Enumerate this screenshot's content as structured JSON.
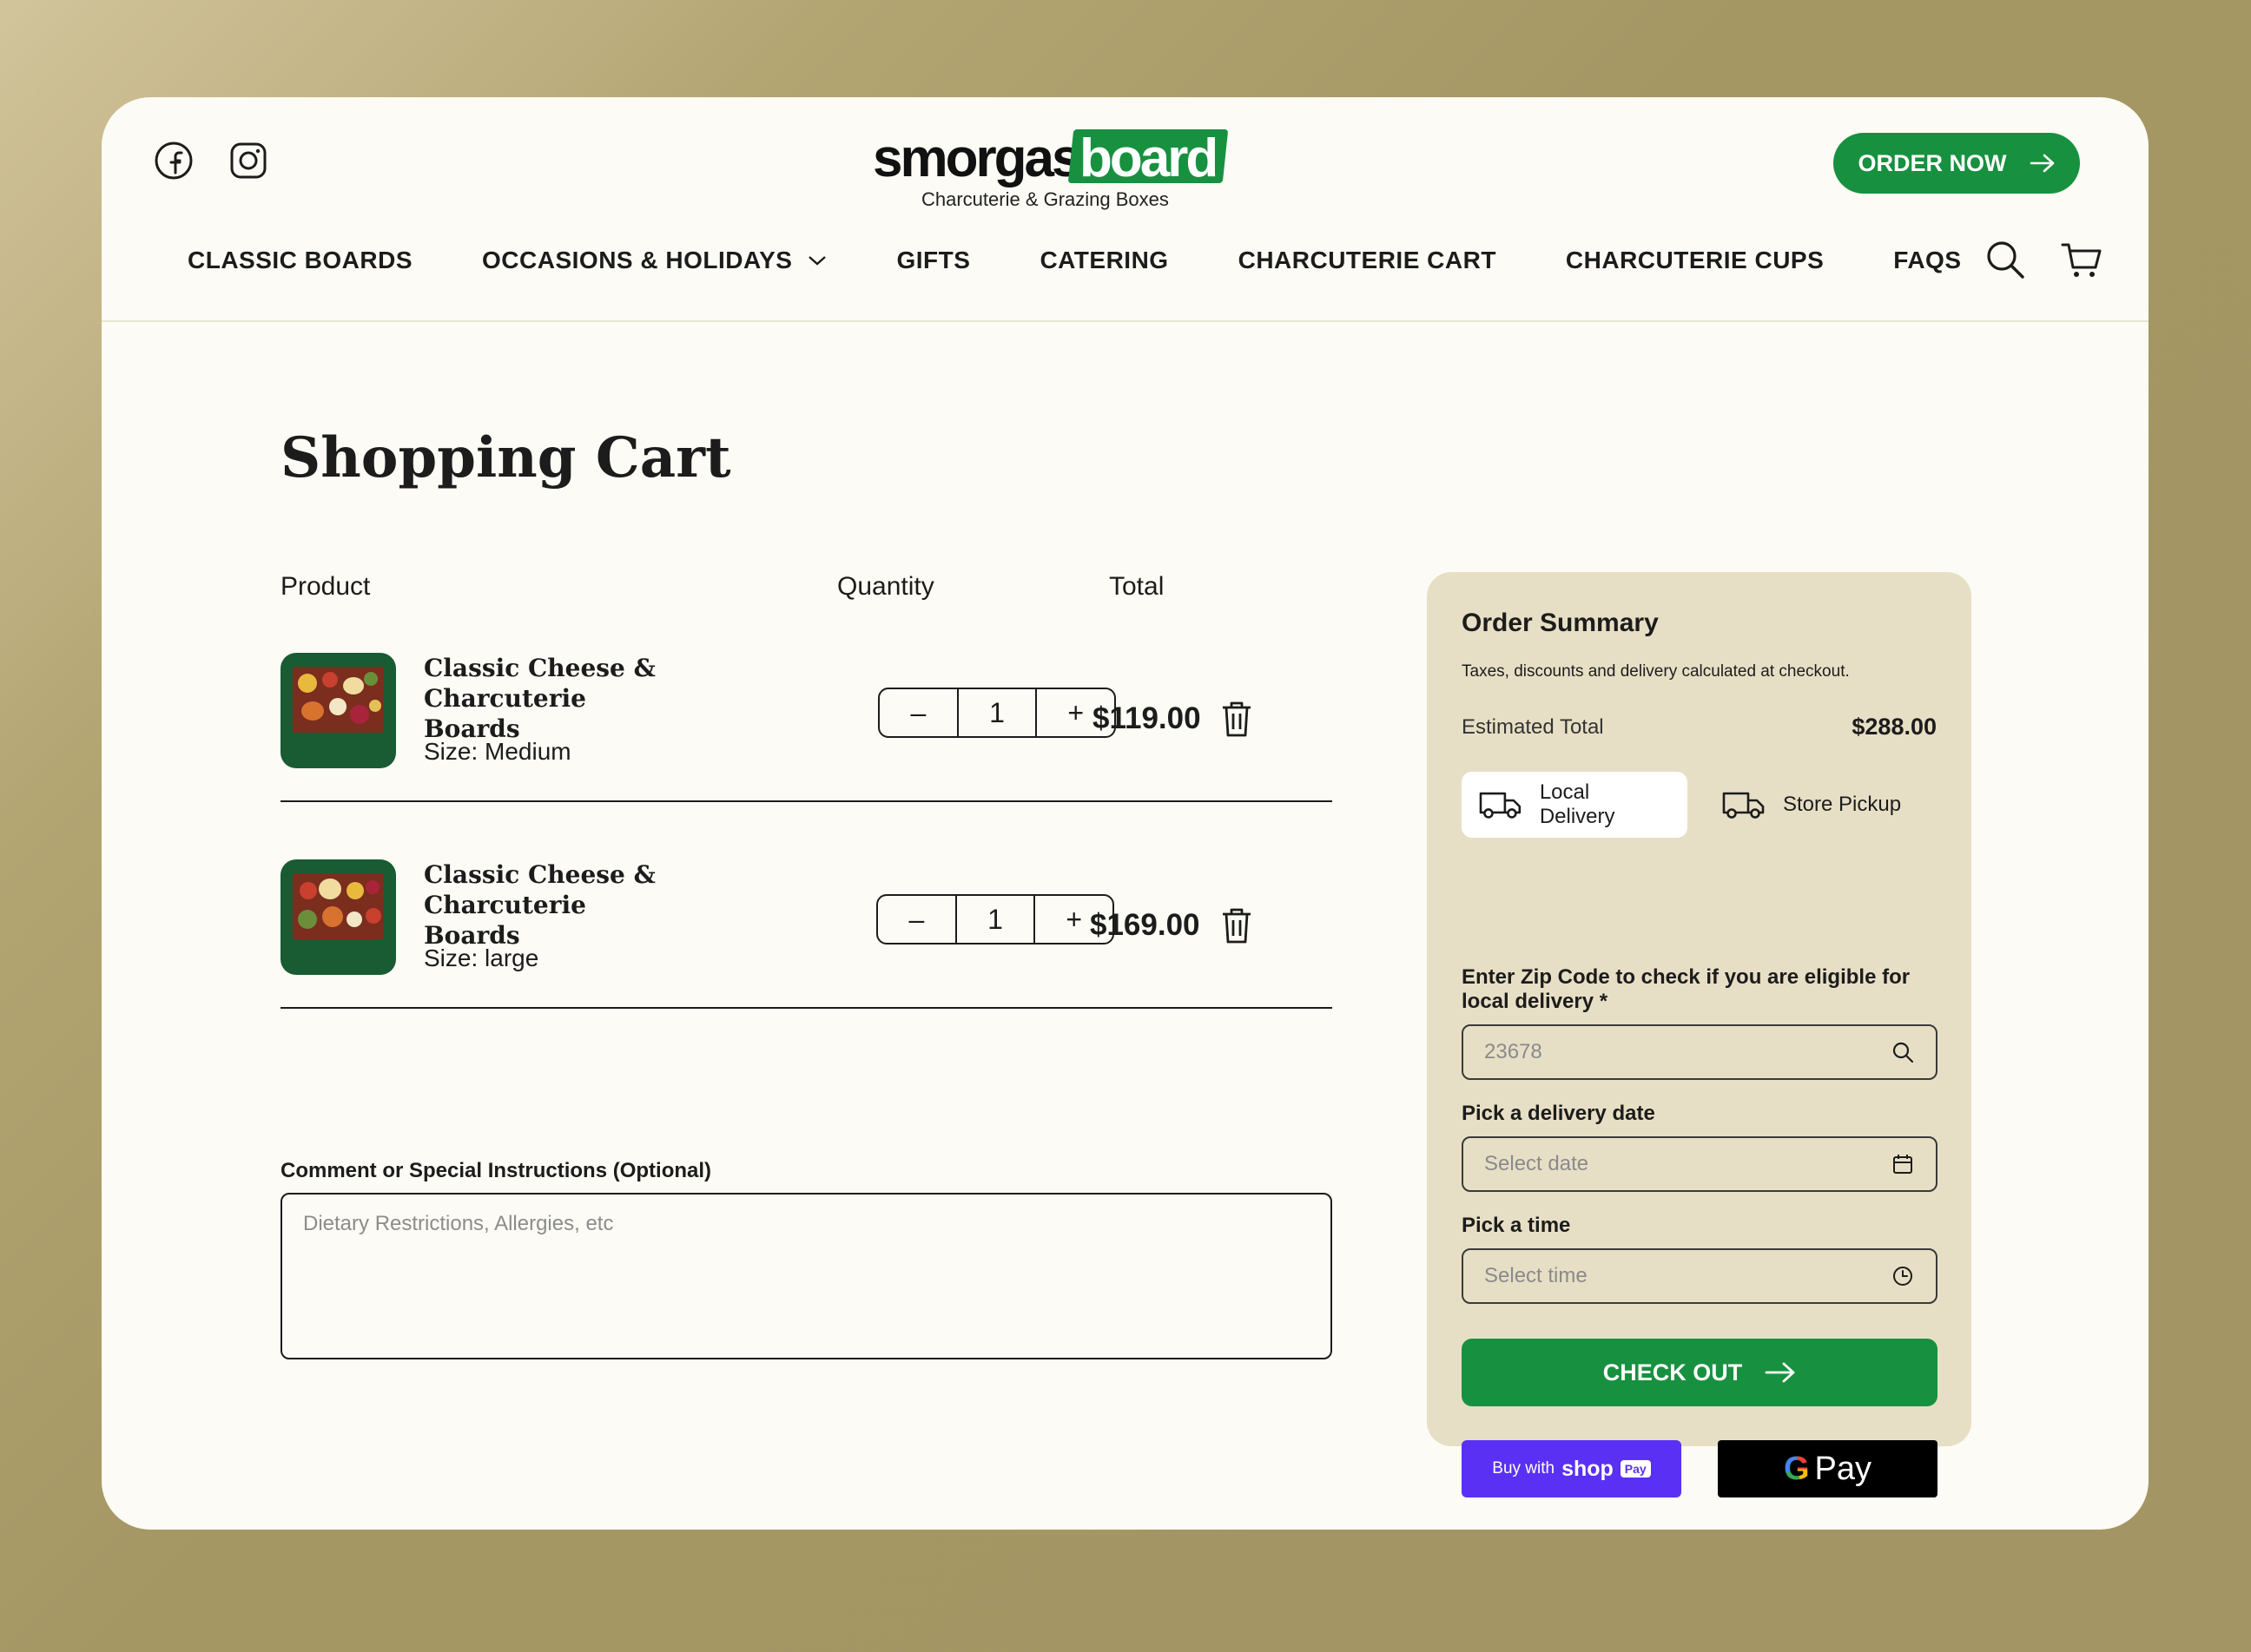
{
  "header": {
    "logo": {
      "word_dark": "smorgas",
      "word_green": "board",
      "tagline": "Charcuterie & Grazing Boxes"
    },
    "order_now_label": "ORDER NOW"
  },
  "nav": {
    "items": [
      {
        "label": "CLASSIC BOARDS"
      },
      {
        "label": "OCCASIONS & HOLIDAYS",
        "has_dropdown": true
      },
      {
        "label": "GIFTS"
      },
      {
        "label": "CATERING"
      },
      {
        "label": "CHARCUTERIE CART"
      },
      {
        "label": "CHARCUTERIE CUPS"
      },
      {
        "label": "FAQS"
      }
    ]
  },
  "page": {
    "title": "Shopping Cart",
    "columns": {
      "product": "Product",
      "quantity": "Quantity",
      "total": "Total"
    }
  },
  "cart": {
    "items": [
      {
        "name": "Classic Cheese & Charcuterie Boards",
        "size": "Size: Medium",
        "quantity": "1",
        "total": "$119.00"
      },
      {
        "name": "Classic Cheese & Charcuterie Boards",
        "size": "Size: large",
        "quantity": "1",
        "total": "$169.00"
      }
    ],
    "minus": "–",
    "plus": "+"
  },
  "comment": {
    "label": "Comment or Special Instructions (Optional)",
    "placeholder": "Dietary Restrictions, Allergies, etc"
  },
  "summary": {
    "title": "Order Summary",
    "subtitle": "Taxes, discounts and delivery calculated at checkout.",
    "estimated_label": "Estimated Total",
    "estimated_value": "$288.00",
    "delivery_options": {
      "local": "Local Delivery",
      "pickup": "Store Pickup",
      "selected": "local"
    },
    "zip_label": "Enter Zip Code to check if you are eligible for local delivery *",
    "zip_value": "23678",
    "date_label": "Pick a delivery date",
    "date_placeholder": "Select date",
    "time_label": "Pick a time",
    "time_placeholder": "Select time",
    "checkout_label": "CHECK OUT",
    "shoppay": {
      "prefix": "Buy with",
      "brand": "shop",
      "pill": "Pay"
    },
    "gpay": {
      "g": "G",
      "label": "Pay"
    }
  },
  "colors": {
    "brand_green": "#17913f",
    "summary_bg": "#e7dfc5",
    "card_bg": "#fcfbf5",
    "shoppay": "#5a31f4"
  }
}
